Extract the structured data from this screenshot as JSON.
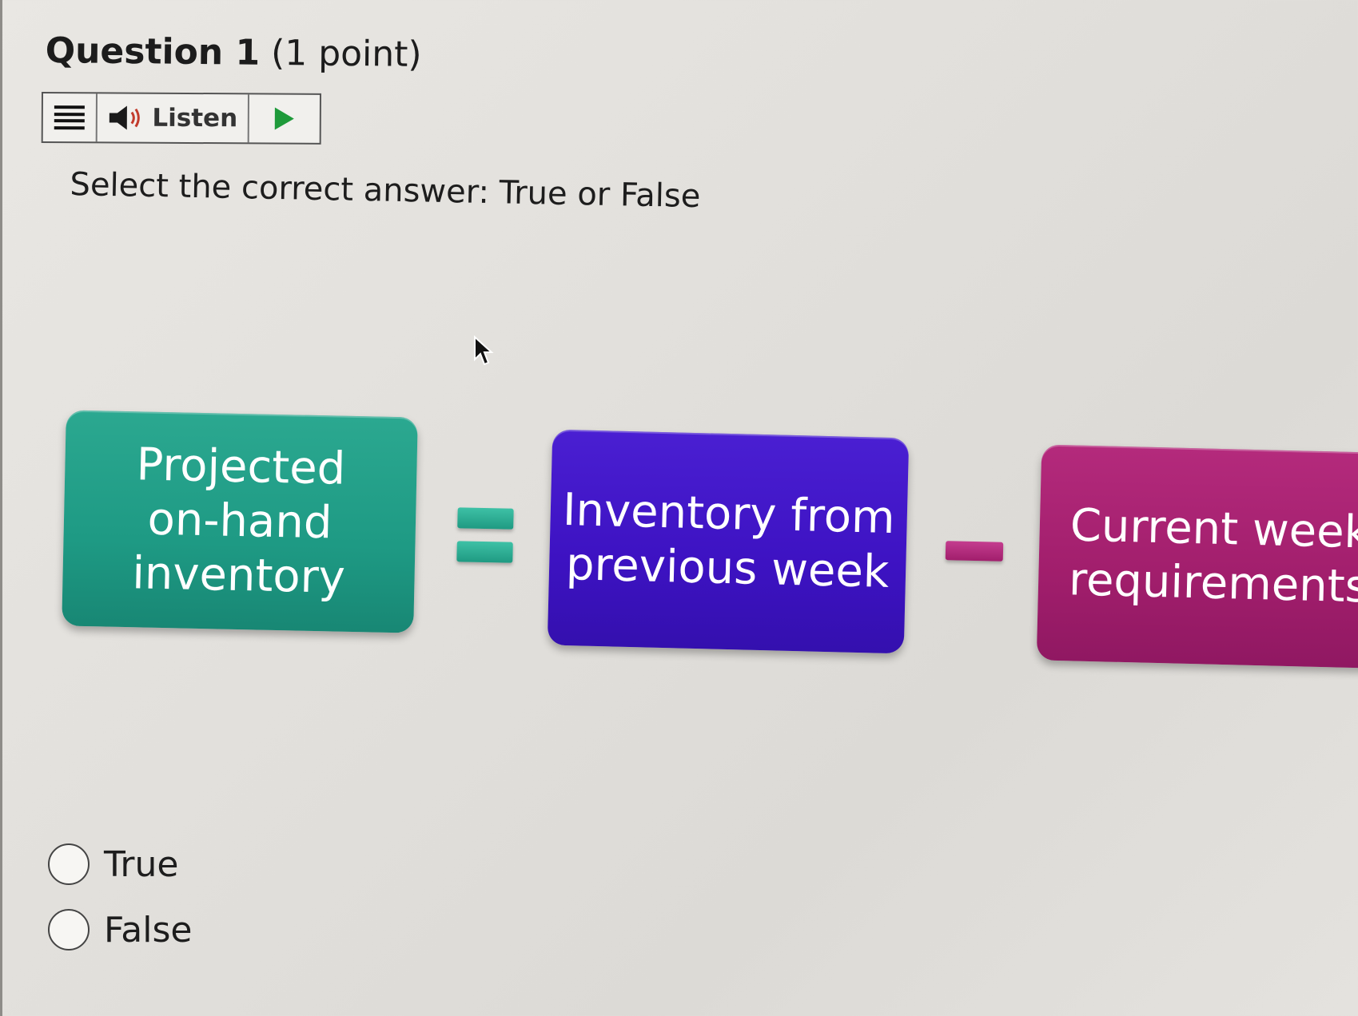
{
  "question": {
    "label": "Question 1",
    "points": "(1 point)"
  },
  "toolbar": {
    "menu_icon": "hamburger-menu-icon",
    "speaker_icon": "speaker-icon",
    "listen_label": "Listen",
    "play_icon": "play-icon",
    "play_color": "#1e9a3a"
  },
  "instruction": "Select the correct answer: True or False",
  "equation": {
    "left_box": {
      "text": "Projected\non-hand\ninventory",
      "color": "#1e9a84"
    },
    "operator1": {
      "symbol": "=",
      "color": "#2bb096"
    },
    "middle_box": {
      "text": "Inventory from\nprevious week",
      "color": "#3d12c2"
    },
    "operator2": {
      "symbol": "-",
      "color": "#b02a7e"
    },
    "right_box": {
      "text": "Current week'\nrequirements",
      "color": "#a11e6c"
    }
  },
  "options": [
    {
      "label": "True",
      "selected": false
    },
    {
      "label": "False",
      "selected": false
    }
  ]
}
